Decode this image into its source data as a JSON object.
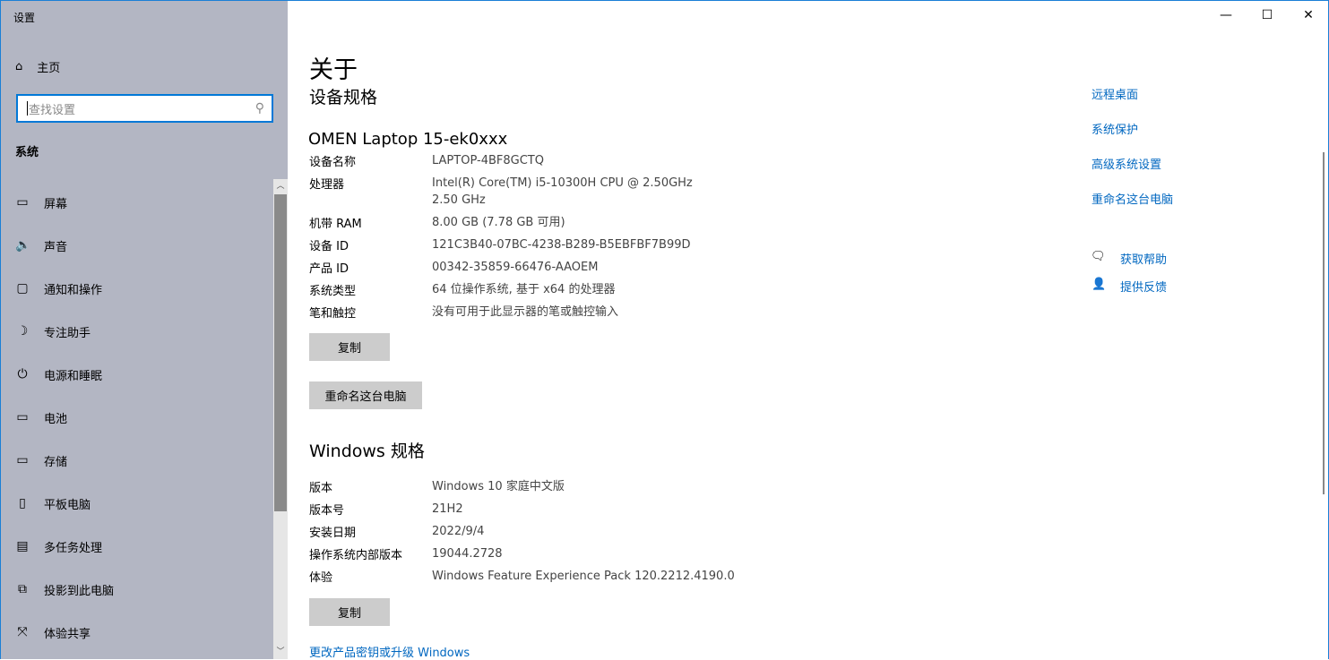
{
  "window": {
    "title": "设置",
    "controls": [
      "—",
      "☐",
      "✕"
    ]
  },
  "sidebar": {
    "home": "主页",
    "search_placeholder": "查找设置",
    "section": "系统",
    "items": [
      {
        "label": "屏幕",
        "icon": "monitor-icon"
      },
      {
        "label": "声音",
        "icon": "speaker-icon"
      },
      {
        "label": "通知和操作",
        "icon": "notification-icon"
      },
      {
        "label": "专注助手",
        "icon": "moon-icon"
      },
      {
        "label": "电源和睡眠",
        "icon": "power-icon"
      },
      {
        "label": "电池",
        "icon": "battery-icon"
      },
      {
        "label": "存储",
        "icon": "storage-icon"
      },
      {
        "label": "平板电脑",
        "icon": "tablet-icon"
      },
      {
        "label": "多任务处理",
        "icon": "multitask-icon"
      },
      {
        "label": "投影到此电脑",
        "icon": "project-icon"
      },
      {
        "label": "体验共享",
        "icon": "share-icon"
      }
    ]
  },
  "main": {
    "title": "关于",
    "device_section": "设备规格",
    "device_name": "OMEN Laptop 15-ek0xxx",
    "device_specs": [
      {
        "k": "设备名称",
        "v": "LAPTOP-4BF8GCTQ"
      },
      {
        "k": "处理器",
        "v": "Intel(R) Core(TM) i5-10300H CPU @ 2.50GHz   2.50 GHz"
      },
      {
        "k": "机带 RAM",
        "v": "8.00 GB (7.78 GB 可用)"
      },
      {
        "k": "设备 ID",
        "v": "121C3B40-07BC-4238-B289-B5EBFBF7B99D"
      },
      {
        "k": "产品 ID",
        "v": "00342-35859-66476-AAOEM"
      },
      {
        "k": "系统类型",
        "v": "64 位操作系统, 基于 x64 的处理器"
      },
      {
        "k": "笔和触控",
        "v": "没有可用于此显示器的笔或触控输入"
      }
    ],
    "copy": "复制",
    "rename": "重命名这台电脑",
    "windows_section": "Windows 规格",
    "windows_specs": [
      {
        "k": "版本",
        "v": "Windows 10 家庭中文版"
      },
      {
        "k": "版本号",
        "v": "21H2"
      },
      {
        "k": "安装日期",
        "v": "2022/9/4"
      },
      {
        "k": "操作系统内部版本",
        "v": "19044.2728"
      },
      {
        "k": "体验",
        "v": "Windows Feature Experience Pack 120.2212.4190.0"
      }
    ],
    "copy2": "复制",
    "change_key": "更改产品密钥或升级 Windows"
  },
  "related": {
    "links": [
      "远程桌面",
      "系统保护",
      "高级系统设置",
      "重命名这台电脑"
    ],
    "help": "获取帮助",
    "feedback": "提供反馈"
  }
}
